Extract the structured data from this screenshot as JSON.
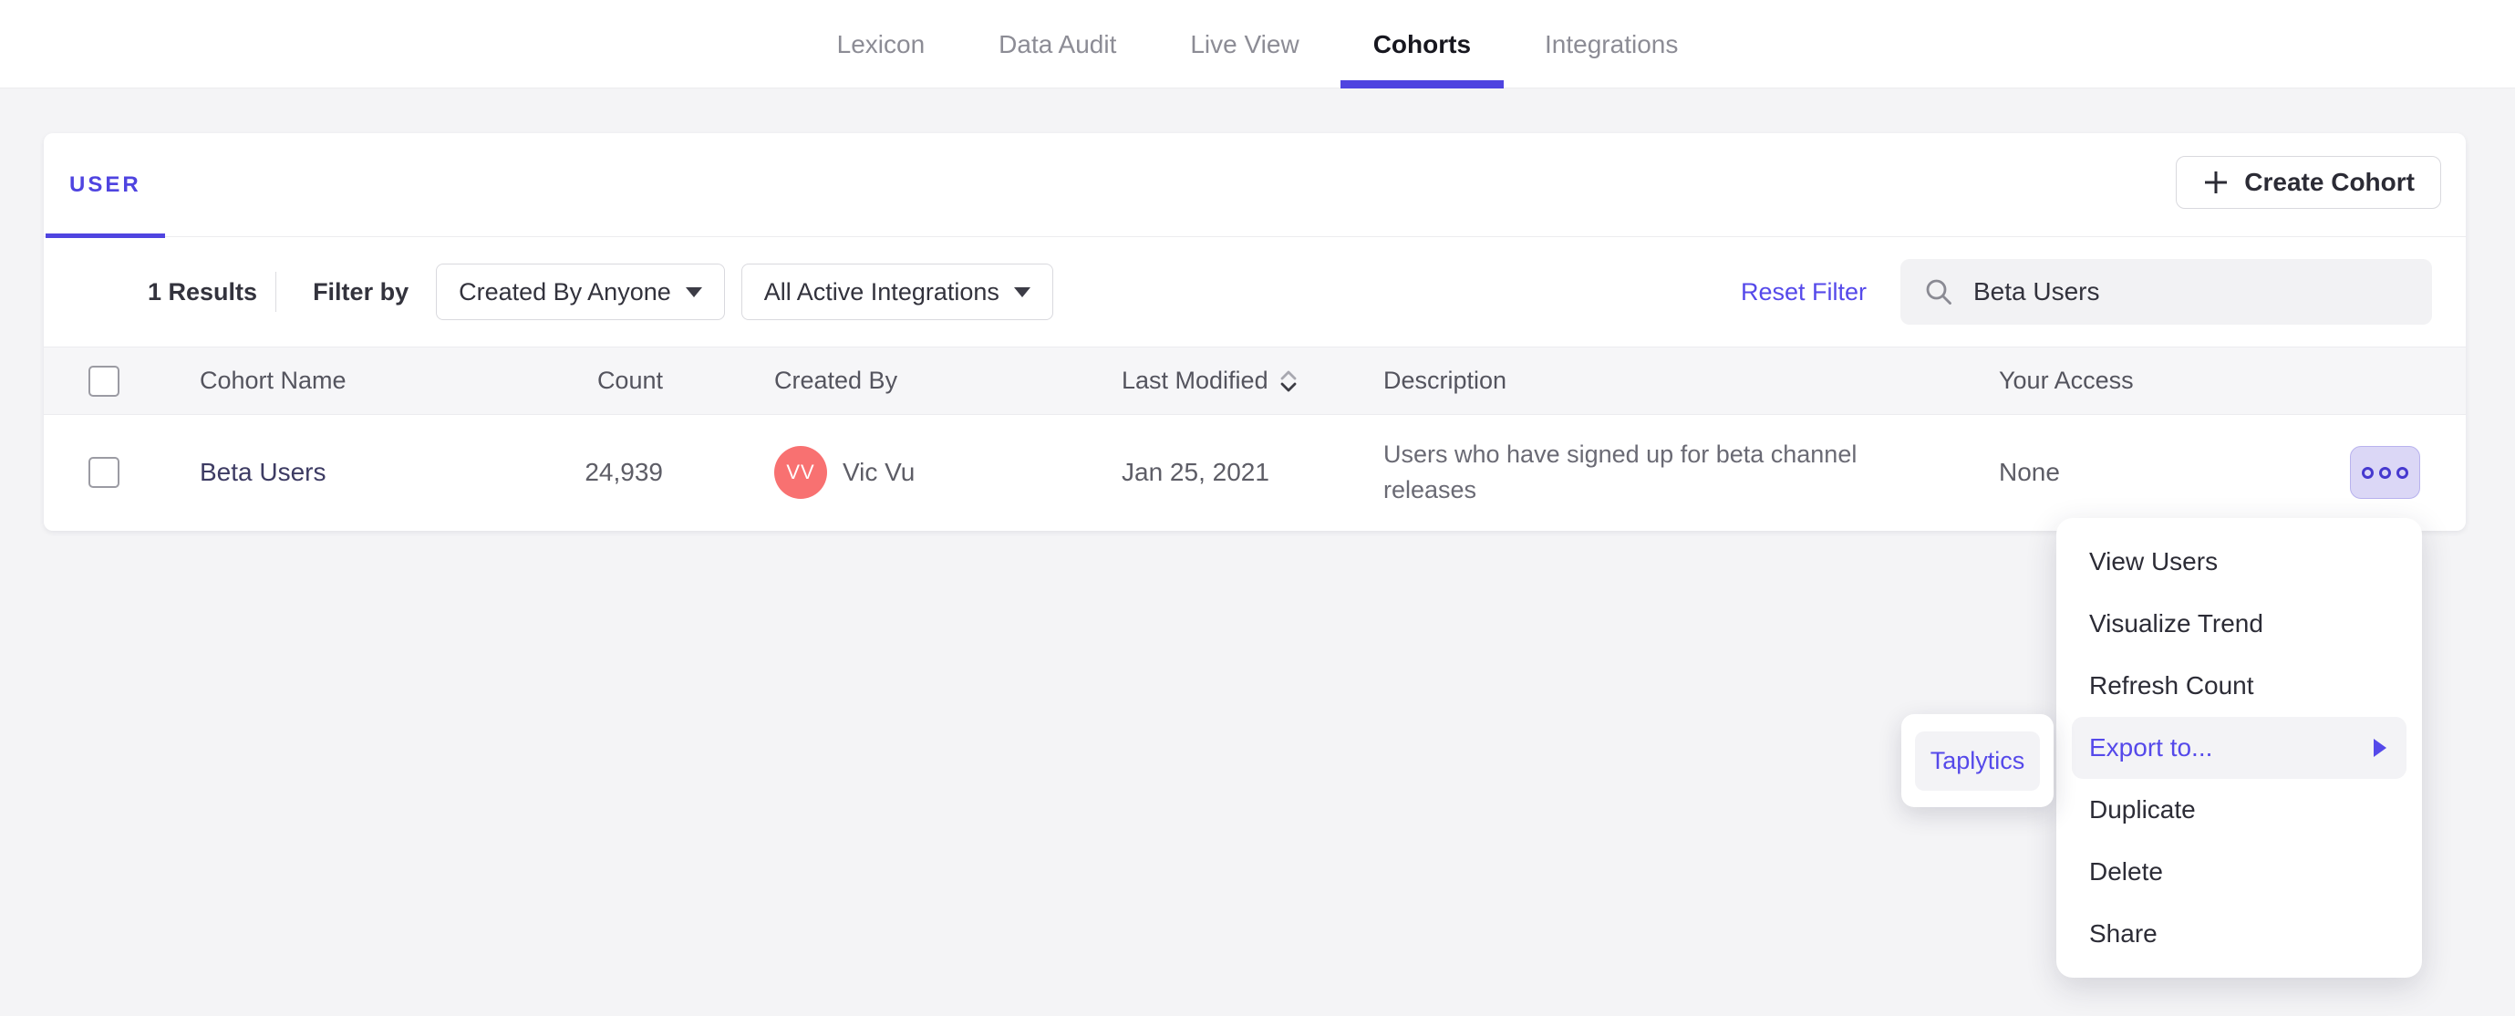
{
  "nav": {
    "tabs": [
      {
        "label": "Lexicon",
        "active": false
      },
      {
        "label": "Data Audit",
        "active": false
      },
      {
        "label": "Live View",
        "active": false
      },
      {
        "label": "Cohorts",
        "active": true
      },
      {
        "label": "Integrations",
        "active": false
      }
    ]
  },
  "cohort_panel": {
    "tab_label": "USER",
    "create_button_label": "Create Cohort",
    "filter_bar": {
      "results_count": "1 Results",
      "filter_by_label": "Filter by",
      "created_by_dropdown": "Created By Anyone",
      "integrations_dropdown": "All Active Integrations",
      "reset_filter_label": "Reset Filter",
      "search": {
        "value": "Beta Users"
      }
    },
    "table": {
      "columns": [
        "Cohort Name",
        "Count",
        "Created By",
        "Last Modified",
        "Description",
        "Your Access"
      ],
      "rows": [
        {
          "name": "Beta Users",
          "count": "24,939",
          "avatar_initials": "VV",
          "created_by": "Vic Vu",
          "last_modified": "Jan 25, 2021",
          "description": "Users who have signed up for beta channel releases",
          "access": "None"
        }
      ]
    }
  },
  "context_menu": {
    "items": [
      {
        "label": "View Users"
      },
      {
        "label": "Visualize Trend"
      },
      {
        "label": "Refresh Count"
      },
      {
        "label": "Export to...",
        "highlighted": true,
        "has_submenu": true
      },
      {
        "label": "Duplicate"
      },
      {
        "label": "Delete"
      },
      {
        "label": "Share"
      }
    ]
  },
  "export_submenu": {
    "items": [
      {
        "label": "Taplytics"
      }
    ]
  },
  "colors": {
    "accent_purple": "#4f44e0",
    "link_purple": "#5549ea",
    "avatar_coral": "#f87171",
    "more_button_bg": "#dbd7f6",
    "page_bg": "#f4f4f6"
  }
}
